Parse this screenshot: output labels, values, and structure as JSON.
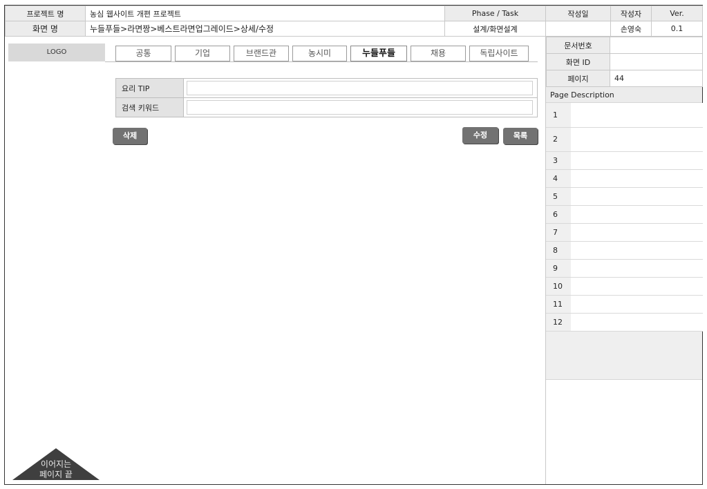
{
  "header": {
    "project_label": "프로젝트 명",
    "project_value": "농심 웹사이트 개편 프로젝트",
    "phase_label": "Phase / Task",
    "phase_value": "설계/화면설계",
    "date_label": "작성일",
    "date_value": "",
    "author_label": "작성자",
    "author_value": "손영숙",
    "ver_label": "Ver.",
    "ver_value": "0.1",
    "screen_label": "화면 명",
    "screen_value": "누들푸들>라면짱>베스트라면업그레이드>상세/수정"
  },
  "logo": "LOGO",
  "gnb": [
    {
      "label": "공통",
      "active": false
    },
    {
      "label": "기업",
      "active": false
    },
    {
      "label": "브랜드관",
      "active": false
    },
    {
      "label": "농시미",
      "active": false
    },
    {
      "label": "누들푸들",
      "active": true
    },
    {
      "label": "채용",
      "active": false
    },
    {
      "label": "독립사이트",
      "active": false
    }
  ],
  "form": {
    "tip_label": "요리 TIP",
    "tip_value": "",
    "keyword_label": "검색 키워드",
    "keyword_value": ""
  },
  "buttons": {
    "delete": "삭제",
    "edit": "수정",
    "list": "목록"
  },
  "continue_marker": {
    "line1": "이어지는",
    "line2": "페이지 끝"
  },
  "doc_meta": {
    "doc_no_label": "문서번호",
    "doc_no_value": "",
    "screen_id_label": "화면 ID",
    "screen_id_value": "",
    "page_label": "페이지",
    "page_value": "44"
  },
  "page_description": {
    "title": "Page Description",
    "rows": [
      {
        "num": "1",
        "text": ""
      },
      {
        "num": "2",
        "text": ""
      },
      {
        "num": "3",
        "text": ""
      },
      {
        "num": "4",
        "text": ""
      },
      {
        "num": "5",
        "text": ""
      },
      {
        "num": "6",
        "text": ""
      },
      {
        "num": "7",
        "text": ""
      },
      {
        "num": "8",
        "text": ""
      },
      {
        "num": "9",
        "text": ""
      },
      {
        "num": "10",
        "text": ""
      },
      {
        "num": "11",
        "text": ""
      },
      {
        "num": "12",
        "text": ""
      }
    ]
  },
  "colors": {
    "button_bg": "#727272",
    "label_bg": "#ececec",
    "logo_bg": "#d9d9d9",
    "marker_bg": "#3f3f3f"
  }
}
